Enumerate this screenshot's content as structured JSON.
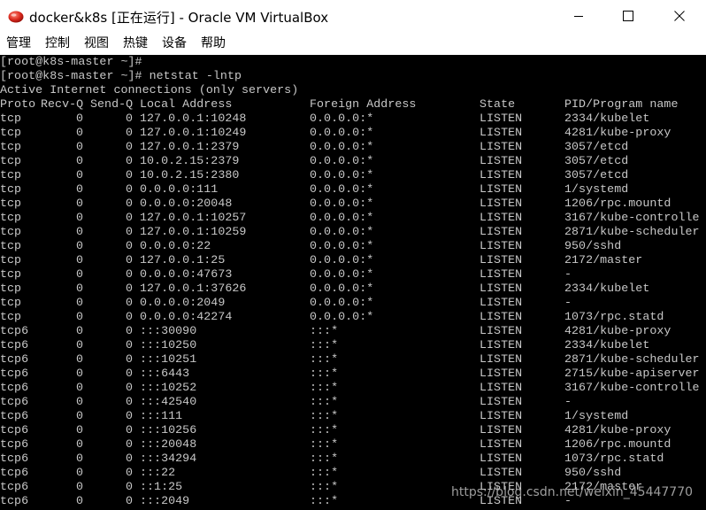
{
  "window": {
    "title": "docker&k8s [正在运行] - Oracle VM VirtualBox",
    "icon": "virtualbox-icon"
  },
  "menubar": {
    "items": [
      "管理",
      "控制",
      "视图",
      "热键",
      "设备",
      "帮助"
    ]
  },
  "console": {
    "prompt_lines": [
      "[root@k8s-master ~]#",
      "[root@k8s-master ~]# netstat -lntp",
      "Active Internet connections (only servers)"
    ],
    "headers": {
      "proto": "Proto",
      "recv": "Recv-Q",
      "send": "Send-Q",
      "local": "Local Address",
      "foreign": "Foreign Address",
      "state": "State",
      "pid": "PID/Program name"
    },
    "rows": [
      {
        "proto": "tcp",
        "recv": "0",
        "send": "0",
        "local": "127.0.0.1:10248",
        "foreign": "0.0.0.0:*",
        "state": "LISTEN",
        "pid": "2334/kubelet"
      },
      {
        "proto": "tcp",
        "recv": "0",
        "send": "0",
        "local": "127.0.0.1:10249",
        "foreign": "0.0.0.0:*",
        "state": "LISTEN",
        "pid": "4281/kube-proxy"
      },
      {
        "proto": "tcp",
        "recv": "0",
        "send": "0",
        "local": "127.0.0.1:2379",
        "foreign": "0.0.0.0:*",
        "state": "LISTEN",
        "pid": "3057/etcd"
      },
      {
        "proto": "tcp",
        "recv": "0",
        "send": "0",
        "local": "10.0.2.15:2379",
        "foreign": "0.0.0.0:*",
        "state": "LISTEN",
        "pid": "3057/etcd"
      },
      {
        "proto": "tcp",
        "recv": "0",
        "send": "0",
        "local": "10.0.2.15:2380",
        "foreign": "0.0.0.0:*",
        "state": "LISTEN",
        "pid": "3057/etcd"
      },
      {
        "proto": "tcp",
        "recv": "0",
        "send": "0",
        "local": "0.0.0.0:111",
        "foreign": "0.0.0.0:*",
        "state": "LISTEN",
        "pid": "1/systemd"
      },
      {
        "proto": "tcp",
        "recv": "0",
        "send": "0",
        "local": "0.0.0.0:20048",
        "foreign": "0.0.0.0:*",
        "state": "LISTEN",
        "pid": "1206/rpc.mountd"
      },
      {
        "proto": "tcp",
        "recv": "0",
        "send": "0",
        "local": "127.0.0.1:10257",
        "foreign": "0.0.0.0:*",
        "state": "LISTEN",
        "pid": "3167/kube-controlle"
      },
      {
        "proto": "tcp",
        "recv": "0",
        "send": "0",
        "local": "127.0.0.1:10259",
        "foreign": "0.0.0.0:*",
        "state": "LISTEN",
        "pid": "2871/kube-scheduler"
      },
      {
        "proto": "tcp",
        "recv": "0",
        "send": "0",
        "local": "0.0.0.0:22",
        "foreign": "0.0.0.0:*",
        "state": "LISTEN",
        "pid": "950/sshd"
      },
      {
        "proto": "tcp",
        "recv": "0",
        "send": "0",
        "local": "127.0.0.1:25",
        "foreign": "0.0.0.0:*",
        "state": "LISTEN",
        "pid": "2172/master"
      },
      {
        "proto": "tcp",
        "recv": "0",
        "send": "0",
        "local": "0.0.0.0:47673",
        "foreign": "0.0.0.0:*",
        "state": "LISTEN",
        "pid": "-"
      },
      {
        "proto": "tcp",
        "recv": "0",
        "send": "0",
        "local": "127.0.0.1:37626",
        "foreign": "0.0.0.0:*",
        "state": "LISTEN",
        "pid": "2334/kubelet"
      },
      {
        "proto": "tcp",
        "recv": "0",
        "send": "0",
        "local": "0.0.0.0:2049",
        "foreign": "0.0.0.0:*",
        "state": "LISTEN",
        "pid": "-"
      },
      {
        "proto": "tcp",
        "recv": "0",
        "send": "0",
        "local": "0.0.0.0:42274",
        "foreign": "0.0.0.0:*",
        "state": "LISTEN",
        "pid": "1073/rpc.statd"
      },
      {
        "proto": "tcp6",
        "recv": "0",
        "send": "0",
        "local": ":::30090",
        "foreign": ":::*",
        "state": "LISTEN",
        "pid": "4281/kube-proxy"
      },
      {
        "proto": "tcp6",
        "recv": "0",
        "send": "0",
        "local": ":::10250",
        "foreign": ":::*",
        "state": "LISTEN",
        "pid": "2334/kubelet"
      },
      {
        "proto": "tcp6",
        "recv": "0",
        "send": "0",
        "local": ":::10251",
        "foreign": ":::*",
        "state": "LISTEN",
        "pid": "2871/kube-scheduler"
      },
      {
        "proto": "tcp6",
        "recv": "0",
        "send": "0",
        "local": ":::6443",
        "foreign": ":::*",
        "state": "LISTEN",
        "pid": "2715/kube-apiserver"
      },
      {
        "proto": "tcp6",
        "recv": "0",
        "send": "0",
        "local": ":::10252",
        "foreign": ":::*",
        "state": "LISTEN",
        "pid": "3167/kube-controlle"
      },
      {
        "proto": "tcp6",
        "recv": "0",
        "send": "0",
        "local": ":::42540",
        "foreign": ":::*",
        "state": "LISTEN",
        "pid": "-"
      },
      {
        "proto": "tcp6",
        "recv": "0",
        "send": "0",
        "local": ":::111",
        "foreign": ":::*",
        "state": "LISTEN",
        "pid": "1/systemd"
      },
      {
        "proto": "tcp6",
        "recv": "0",
        "send": "0",
        "local": ":::10256",
        "foreign": ":::*",
        "state": "LISTEN",
        "pid": "4281/kube-proxy"
      },
      {
        "proto": "tcp6",
        "recv": "0",
        "send": "0",
        "local": ":::20048",
        "foreign": ":::*",
        "state": "LISTEN",
        "pid": "1206/rpc.mountd"
      },
      {
        "proto": "tcp6",
        "recv": "0",
        "send": "0",
        "local": ":::34294",
        "foreign": ":::*",
        "state": "LISTEN",
        "pid": "1073/rpc.statd"
      },
      {
        "proto": "tcp6",
        "recv": "0",
        "send": "0",
        "local": ":::22",
        "foreign": ":::*",
        "state": "LISTEN",
        "pid": "950/sshd"
      },
      {
        "proto": "tcp6",
        "recv": "0",
        "send": "0",
        "local": "::1:25",
        "foreign": ":::*",
        "state": "LISTEN",
        "pid": "2172/master"
      },
      {
        "proto": "tcp6",
        "recv": "0",
        "send": "0",
        "local": ":::2049",
        "foreign": ":::*",
        "state": "LISTEN",
        "pid": "-"
      }
    ]
  },
  "watermark": "https://blog.csdn.net/weixin_45447770",
  "colors": {
    "console_bg": "#000000",
    "console_text": "#c8c8c8",
    "titlebar_bg": "#ffffff"
  }
}
